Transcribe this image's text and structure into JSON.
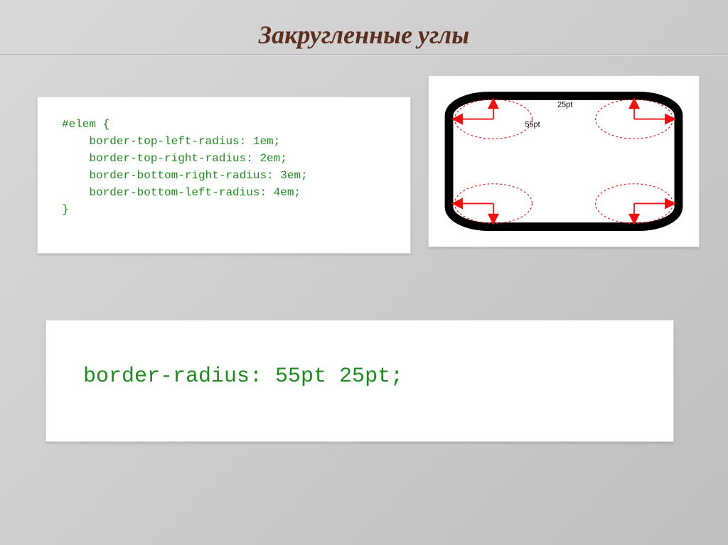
{
  "title": "Закругленные углы",
  "code1": {
    "l1": "#elem {",
    "l2": "    border-top-left-radius: 1em;",
    "l3": "    border-top-right-radius: 2em;",
    "l4": "    border-bottom-right-radius: 3em;",
    "l5": "    border-bottom-left-radius: 4em;",
    "l6": "}"
  },
  "code2": "border-radius: 55pt 25pt;",
  "diagram": {
    "label_v": "25pt",
    "label_h": "55pt"
  }
}
